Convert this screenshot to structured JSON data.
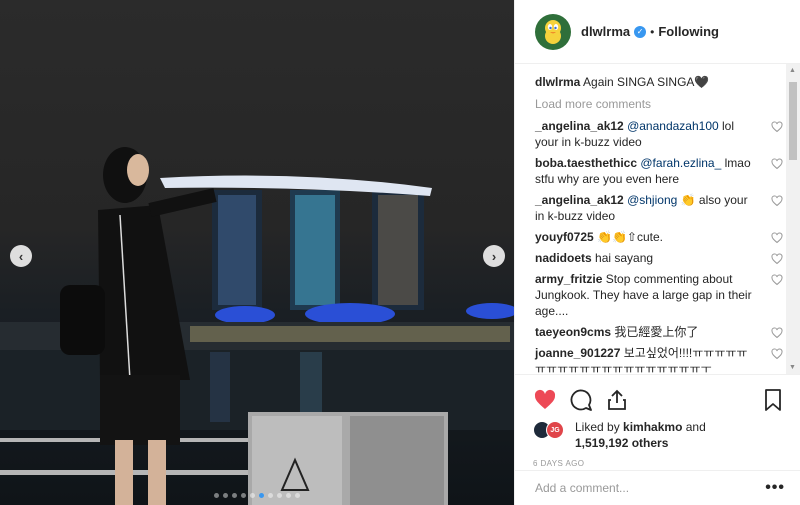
{
  "post": {
    "username": "dlwlrma",
    "follow_sep": "•",
    "follow_status": "Following",
    "caption_user": "dlwlrma",
    "caption_text": "Again SINGA SINGA🖤",
    "load_more": "Load more comments",
    "comments": [
      {
        "user": "_angelina_ak12",
        "mention": "@anandazah100",
        "text": " lol your in k-buzz video"
      },
      {
        "user": "boba.taesthethicc",
        "mention": "@farah.ezlina_",
        "text": " lmao stfu why are you even here"
      },
      {
        "user": "_angelina_ak12",
        "mention": "@shjiong",
        "text": " 👏 also your in k-buzz video"
      },
      {
        "user": "youyf0725",
        "mention": "",
        "text": "👏👏⇧cute."
      },
      {
        "user": "nadidoets",
        "mention": "",
        "text": "hai sayang"
      },
      {
        "user": "army_fritzie",
        "mention": "",
        "text": "Stop commenting about Jungkook. They have a large gap in their age...."
      },
      {
        "user": "taeyeon9cms",
        "mention": "",
        "text": "我已經愛上你了"
      },
      {
        "user": "joanne_901227",
        "mention": "",
        "text": "보고싶었어!!!!ㅠㅠㅠㅠㅠㅠㅠㅠㅠㅠㅠㅠㅠㅠㅠㅠㅠㅠㅠㅠㅜ"
      }
    ],
    "liked_by_prefix": "Liked by",
    "liked_by_user": "kimhakmo",
    "liked_by_and": "and",
    "likes_count": "1,519,192 others",
    "timestamp": "6 DAYS AGO",
    "add_comment_placeholder": "Add a comment...",
    "more_label": "•••",
    "avatar_badge": "JG"
  },
  "carousel": {
    "total": 10,
    "active_index": 5,
    "prev": "‹",
    "next": "›"
  },
  "colors": {
    "heart_liked": "#ed4956",
    "verified": "#3897f0",
    "mention": "#003569"
  },
  "icons": [
    "heart-icon",
    "comment-icon",
    "share-icon",
    "bookmark-icon",
    "verified-icon",
    "more-icon"
  ]
}
